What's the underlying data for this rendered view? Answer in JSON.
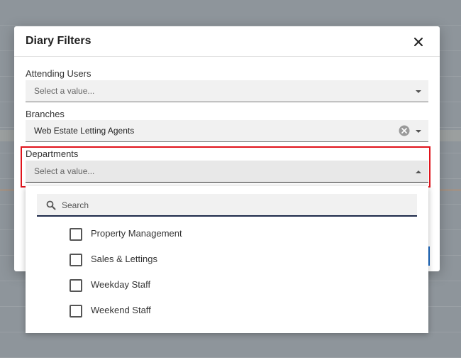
{
  "dialog": {
    "title": "Diary Filters",
    "close_icon": "close-icon"
  },
  "fields": {
    "attending_users": {
      "label": "Attending Users",
      "placeholder": "Select a value..."
    },
    "branches": {
      "label": "Branches",
      "value": "Web Estate Letting Agents"
    },
    "departments": {
      "label": "Departments",
      "placeholder": "Select a value..."
    }
  },
  "dropdown": {
    "search_placeholder": "Search",
    "options": [
      {
        "label": "Property Management",
        "checked": false
      },
      {
        "label": "Sales & Lettings",
        "checked": false
      },
      {
        "label": "Weekday Staff",
        "checked": false
      },
      {
        "label": "Weekend Staff",
        "checked": false
      }
    ]
  },
  "colors": {
    "highlight": "#e0131b",
    "search_underline": "#1e2a4a",
    "primary": "#1565c0"
  }
}
